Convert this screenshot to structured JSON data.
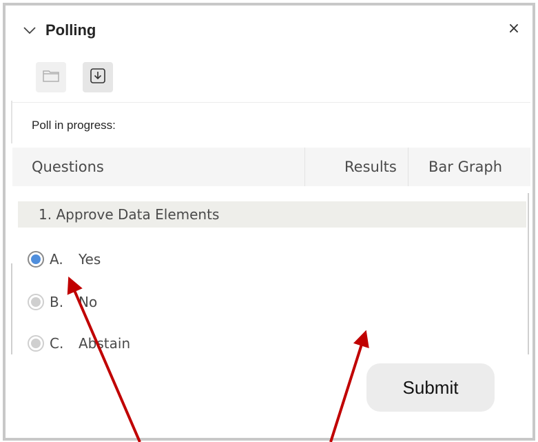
{
  "panel": {
    "title": "Polling",
    "close_label": "×"
  },
  "toolbar": {
    "items": [
      {
        "icon": "folder-icon",
        "state": "disabled"
      },
      {
        "icon": "download-icon",
        "state": "enabled"
      }
    ]
  },
  "status": "Poll in progress:",
  "table": {
    "columns": [
      "Questions",
      "Results",
      "Bar Graph"
    ]
  },
  "question": {
    "label": "1.  Approve Data Elements",
    "options": [
      {
        "letter": "A.",
        "text": "Yes",
        "selected": true,
        "enabled": true
      },
      {
        "letter": "B.",
        "text": "No",
        "selected": false,
        "enabled": false
      },
      {
        "letter": "C.",
        "text": "Abstain",
        "selected": false,
        "enabled": false
      }
    ]
  },
  "submit_label": "Submit",
  "colors": {
    "accent": "#4f8edc",
    "annotation_arrow": "#c00000"
  }
}
